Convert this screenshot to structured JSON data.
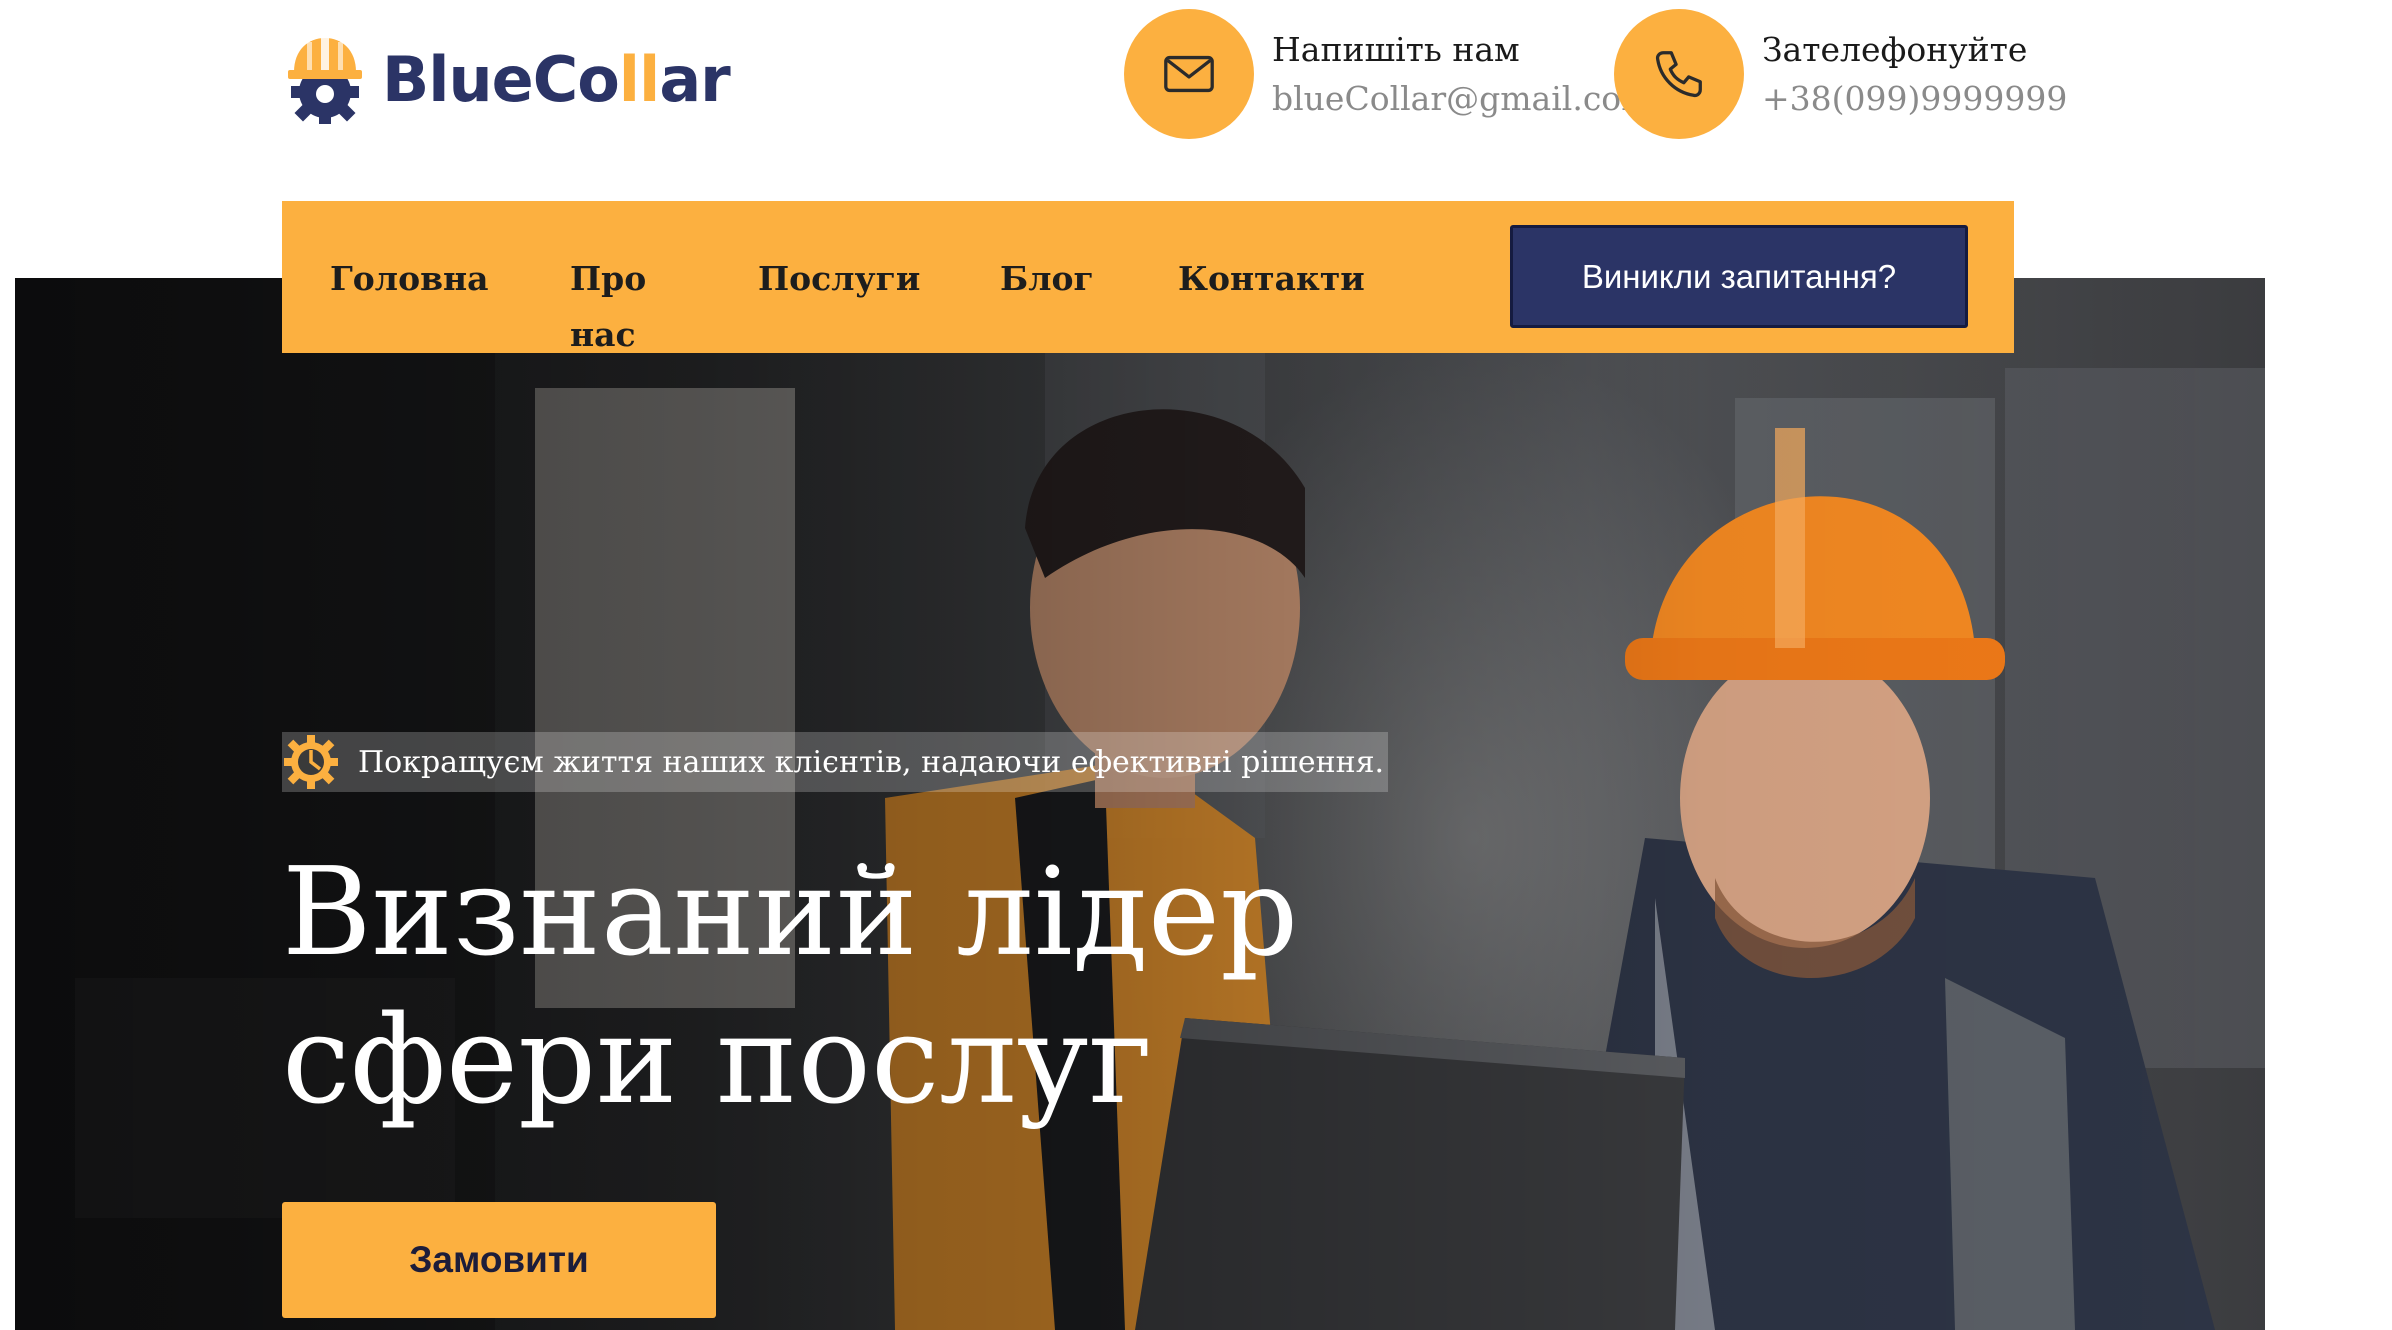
{
  "brand": {
    "name_part1": "BlueCo",
    "name_accent": "ll",
    "name_part2": "ar",
    "logo_icon": "gear-hardhat-icon"
  },
  "header": {
    "email": {
      "icon": "envelope-icon",
      "label": "Напишіть нам",
      "value": "blueCollar@gmail.com"
    },
    "phone": {
      "icon": "phone-icon",
      "label": "Зателефонуйте",
      "value": "+38(099)9999999"
    }
  },
  "nav": {
    "items": [
      {
        "label": "Головна"
      },
      {
        "label": "Про нас"
      },
      {
        "label": "Послуги"
      },
      {
        "label": "Блог"
      },
      {
        "label": "Контакти"
      }
    ],
    "cta_label": "Виникли запитання?"
  },
  "hero": {
    "tagline_icon": "gear-icon",
    "tagline": "Покращуєм життя наших клієнтів, надаючи ефективні рішення.",
    "title_line1": "Визнаний лідер",
    "title_line2": "сфери послуг",
    "cta_label": "Замовити",
    "image": "two-factory-workers-with-laptop-photo"
  },
  "colors": {
    "accent": "#fcb040",
    "brand_navy": "#2b3466",
    "text_dark": "#1d1d1d",
    "text_muted": "#8a8a8a"
  }
}
